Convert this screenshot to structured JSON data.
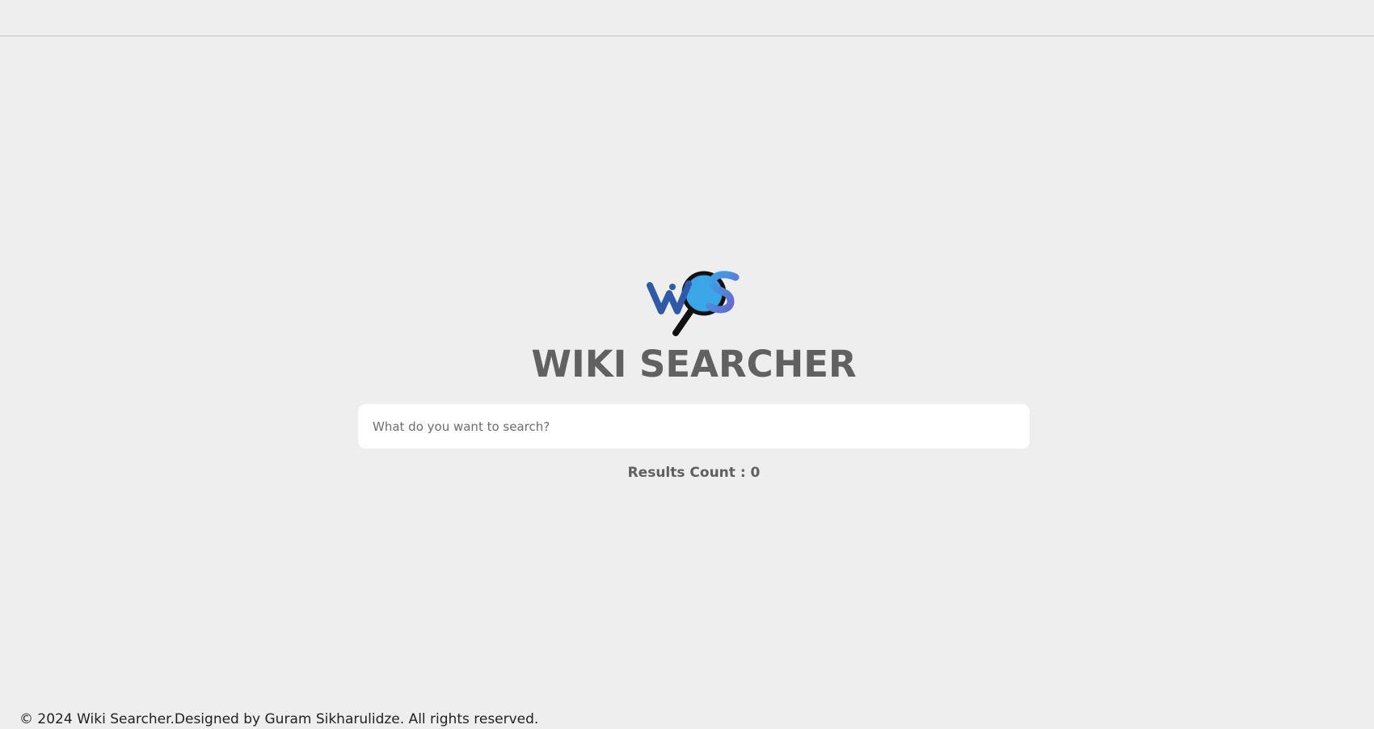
{
  "header": {},
  "brand": {
    "logo_icon": "wiki-searcher-magnifier-logo",
    "logo_text": "WS",
    "title": "WIKI SEARCHER"
  },
  "search": {
    "placeholder": "What do you want to search?",
    "value": ""
  },
  "results": {
    "label": "Results Count : 0"
  },
  "footer": {
    "text": "© 2024 Wiki Searcher.Designed by Guram Sikharulidze. All rights reserved."
  },
  "colors": {
    "background": "#eeeeee",
    "title": "#616161",
    "logo_blue_dark": "#2f5aa8",
    "logo_blue_light": "#3aa6e8",
    "logo_handle": "#111111"
  }
}
